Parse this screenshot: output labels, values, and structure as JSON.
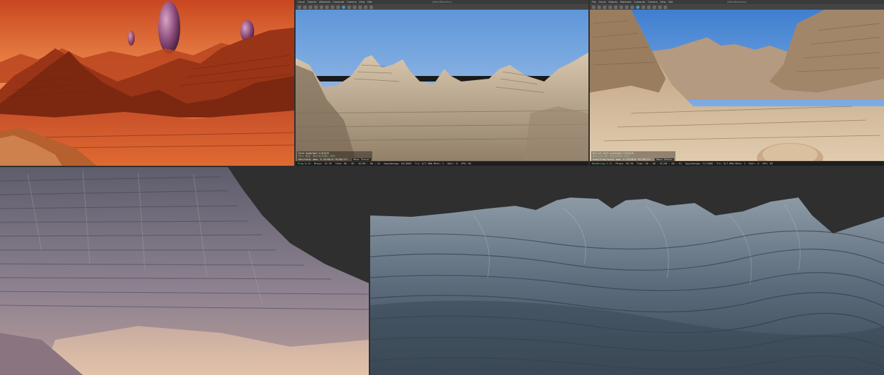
{
  "collage": {
    "panels": [
      {
        "id": "mars",
        "description_icon": "landscape-image"
      },
      {
        "id": "app1"
      },
      {
        "id": "app2"
      },
      {
        "id": "canyon",
        "description_icon": "landscape-image"
      },
      {
        "id": "strata",
        "description_icon": "landscape-image"
      }
    ]
  },
  "app1": {
    "menu": [
      "Cloud",
      "Objects",
      "Materials",
      "Compute",
      "Camera",
      "Help",
      "Edit"
    ],
    "window_title": "[WorldMachine]",
    "overlay": {
      "line1": "Core quad/max:2/0/0/0",
      "line2a": "Tri: 0/0",
      "line2b": "Ppl/k/2/64: 0/0",
      "line3": "Geo/total mem: 0.29/GB/0.70/GB/1Tr",
      "camera_label": "Main Textur"
    },
    "status": {
      "progress": "Prog 8.4%",
      "mrays": "Mrays: 42.70",
      "time": "Time: 00 : 00 : 02/00 : 00 : 41",
      "spp": "Spp/maxspp: 84/1000",
      "tri": "Tri: 0/7.0Mm Mesh: 1",
      "hair": "Hair: 0",
      "gpu": "GPU: 85"
    },
    "colors": {
      "sky_top": "#5e96d8",
      "sky_bottom": "#a9c8ea",
      "rock": "#b8a58c"
    }
  },
  "app2": {
    "menu": [
      "File",
      "Cloud",
      "Objects",
      "Materials",
      "Compute",
      "Camera",
      "Help",
      "Edit"
    ],
    "window_title": "[WorldMachine]",
    "overlay": {
      "line1": "Out-of-core used/max:2/0/0/0",
      "line2a": "Gm/t/74.30",
      "line2b": "Pgk/2/64: 0/0",
      "line3": "Used/free/total mem: 0.29/GB/0.70/GB/1Tr",
      "camera_label": "Main Textur"
    },
    "status": {
      "progress": "Rendering 2.2%",
      "mrays": "Mrays: 30.90",
      "time": "Time: 00 : 00 : 01/00 : 00 : 51",
      "spp": "Spp/maxspp: 22/1000",
      "tri": "Tri: 0/7.0Mm Mesh: 1",
      "hair": "Hair: 0",
      "gpu": "GPU: 85"
    },
    "colors": {
      "sky_top": "#3f7fd0",
      "sky_bottom": "#9fc3ec",
      "rock": "#c7ac8a"
    }
  },
  "mars": {
    "colors": {
      "sky": "#d9562a",
      "haze": "#f0894a",
      "rock": "#8f2e14",
      "planet": "#a86a9a"
    }
  },
  "canyon": {
    "colors": {
      "rock": "#6b6a78",
      "rock_light": "#a79a99",
      "sand": "#d8b8a2"
    }
  },
  "strata": {
    "colors": {
      "rock": "#46586a",
      "rock_light": "#8d9aa6",
      "dark": "#2a333e"
    }
  }
}
